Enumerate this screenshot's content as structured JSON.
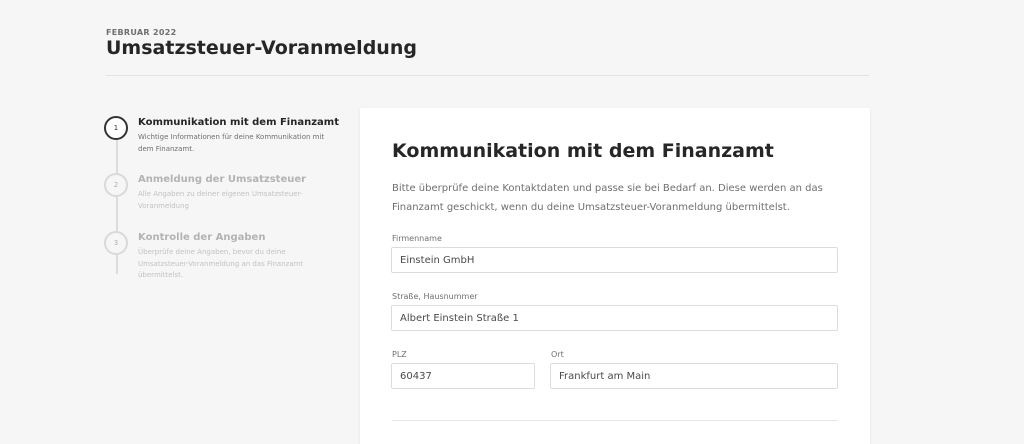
{
  "header": {
    "eyebrow": "FEBRUAR 2022",
    "title": "Umsatzsteuer-Voranmeldung"
  },
  "stepper": {
    "steps": [
      {
        "number": "1",
        "title": "Kommunikation mit dem Finanzamt",
        "description": "Wichtige Informationen für deine Kommunikation mit dem Finanzamt.",
        "active": true
      },
      {
        "number": "2",
        "title": "Anmeldung der Umsatzsteuer",
        "description": "Alle Angaben zu deiner eigenen Umsatzsteuer-Voranmeldung",
        "active": false
      },
      {
        "number": "3",
        "title": "Kontrolle der Angaben",
        "description": "Überprüfe deine Angaben, bevor du deine Umsatzsteuer-Voranmeldung an das Finanzamt übermittelst.",
        "active": false
      }
    ]
  },
  "card": {
    "title": "Kommunikation mit dem Finanzamt",
    "intro": "Bitte überprüfe deine Kontaktdaten und passe sie bei Bedarf an. Diese werden an das Finanzamt geschickt, wenn du deine Umsatzsteuer-Voranmeldung übermittelst.",
    "fields": {
      "company": {
        "label": "Firmenname",
        "value": "Einstein GmbH"
      },
      "street": {
        "label": "Straße, Hausnummer",
        "value": "Albert Einstein Straße 1"
      },
      "zip": {
        "label": "PLZ",
        "value": "60437"
      },
      "city": {
        "label": "Ort",
        "value": "Frankfurt am Main"
      }
    }
  },
  "colors": {
    "background": "#f6f6f6",
    "card": "#ffffff",
    "text_primary": "#262626",
    "text_secondary": "#6f6f6f",
    "text_disabled": "#b3b3b3"
  }
}
